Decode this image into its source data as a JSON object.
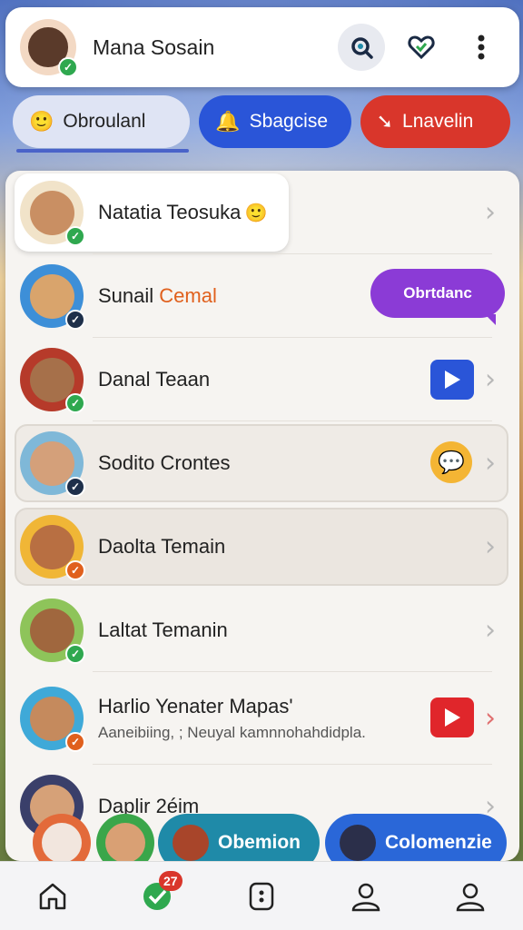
{
  "header": {
    "user_name": "Mana Sosain",
    "icons": [
      "search-icon",
      "heart-icon",
      "more-icon"
    ]
  },
  "tabs": [
    {
      "label": "Obroulanl",
      "icon": "person-icon"
    },
    {
      "label": "Sbagcise",
      "icon": "bell-icon"
    },
    {
      "label": "Lnavelin",
      "icon": "arrow-icon"
    }
  ],
  "contacts": [
    {
      "name": "Natatia Teosuka",
      "status": "online"
    },
    {
      "name_part1": "Sunail ",
      "name_part2": "Cemal",
      "status": "dark",
      "bubble": "Obrtdanc"
    },
    {
      "name": "Danal Teaan",
      "status": "online"
    },
    {
      "name": "Sodito Crontes",
      "status": "dark"
    },
    {
      "name": "Daolta Temain",
      "status": "orange"
    },
    {
      "name": "Laltat Temanin",
      "status": "online"
    },
    {
      "name": "Harlio Yenater Mapas'",
      "sub": "Aaneibiing, ; Neuyal kamnnohahdidpla.",
      "status": "orange"
    },
    {
      "name": "Daplir 2éim",
      "status": "online"
    }
  ],
  "actions": [
    {
      "label": "Obemion"
    },
    {
      "label": "Colomenzie"
    }
  ],
  "nav": {
    "items": [
      "home-icon",
      "chat-icon",
      "lock-icon",
      "profile-icon",
      "account-icon"
    ],
    "badge": "27"
  },
  "colors": {
    "primary": "#2a55d8",
    "danger": "#d9362b",
    "online": "#2fa84f",
    "purple": "#8b3bd6",
    "teal": "#1f8aa8"
  }
}
